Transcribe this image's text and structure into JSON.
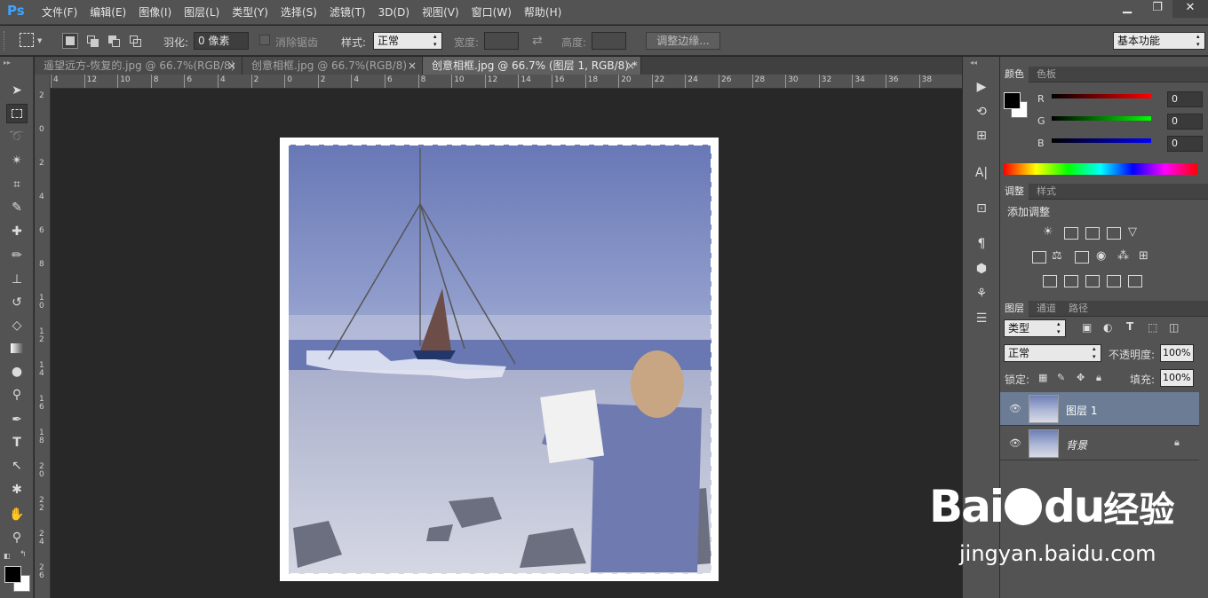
{
  "app": {
    "logo": "Ps"
  },
  "menu": [
    "文件(F)",
    "编辑(E)",
    "图像(I)",
    "图层(L)",
    "类型(Y)",
    "选择(S)",
    "滤镜(T)",
    "3D(D)",
    "视图(V)",
    "窗口(W)",
    "帮助(H)"
  ],
  "window_controls": {
    "minimize": "▁",
    "restore": "❐",
    "close": "✕"
  },
  "options": {
    "feather_label": "羽化:",
    "feather_value": "0 像素",
    "antialias_label": "消除锯齿",
    "style_label": "样式:",
    "style_value": "正常",
    "width_label": "宽度:",
    "height_label": "高度:",
    "refine_button": "调整边缘...",
    "workspace": "基本功能"
  },
  "tabs": [
    {
      "label": "遥望远方-恢复的.jpg @ 66.7%(RGB/8)"
    },
    {
      "label": "创意相框.jpg @ 66.7%(RGB/8)"
    },
    {
      "label": "创意相框.jpg @ 66.7% (图层 1, RGB/8) *"
    }
  ],
  "tab_close": "×",
  "ruler_h": [
    "4",
    "12",
    "10",
    "8",
    "6",
    "4",
    "2",
    "0",
    "2",
    "4",
    "6",
    "8",
    "10",
    "12",
    "14",
    "16",
    "18",
    "20",
    "22",
    "24",
    "26",
    "28",
    "30",
    "32",
    "34",
    "36",
    "38"
  ],
  "ruler_v": [
    "2",
    "0",
    "2",
    "4",
    "6",
    "8",
    "1\n0",
    "1\n2",
    "1\n4",
    "1\n6",
    "1\n8",
    "2\n0",
    "2\n2",
    "2\n4",
    "2\n6"
  ],
  "color_panel": {
    "tabs": [
      "颜色",
      "色板"
    ],
    "r_label": "R",
    "g_label": "G",
    "b_label": "B",
    "r_value": "0",
    "g_value": "0",
    "b_value": "0"
  },
  "adjust_panel": {
    "tabs": [
      "调整",
      "样式"
    ],
    "title": "添加调整"
  },
  "layers_panel": {
    "tabs": [
      "图层",
      "通道",
      "路径"
    ],
    "filter_type": "类型",
    "blend_mode": "正常",
    "opacity_label": "不透明度:",
    "opacity_value": "100%",
    "lock_label": "锁定:",
    "fill_label": "填充:",
    "fill_value": "100%",
    "layers": [
      {
        "name": "图层 1",
        "selected": true
      },
      {
        "name": "背景",
        "selected": false
      }
    ]
  },
  "watermark": {
    "brand": "Bai",
    "brand2": "du",
    "cn": "经验",
    "url": "jingyan.baidu.com"
  },
  "colors": {
    "accent": "#3fa3ff",
    "selected_layer": "#6b7c94",
    "panel": "#535353"
  }
}
